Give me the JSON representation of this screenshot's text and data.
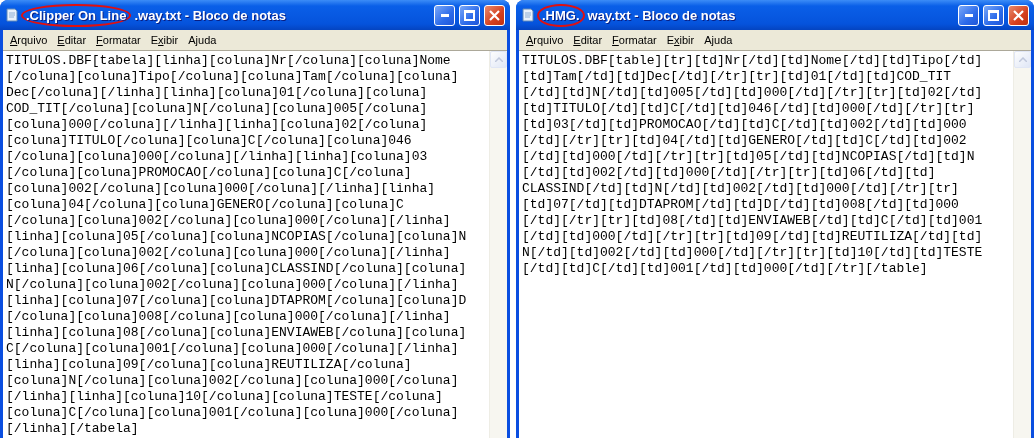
{
  "windows": [
    {
      "title_parts": [
        {
          "text": ".Clipper On Line",
          "circled": true
        },
        {
          "text": ".way.txt - Bloco de notas",
          "circled": false
        }
      ],
      "menu": [
        {
          "key": "A",
          "after": "rquivo"
        },
        {
          "key": "E",
          "after": "ditar"
        },
        {
          "key": "F",
          "after": "ormatar"
        },
        {
          "before": "E",
          "key": "x",
          "after": "ibir"
        },
        {
          "before": "A",
          "key": "j",
          "after": "uda"
        }
      ],
      "lines": [
        "TITULOS.DBF[tabela][linha][coluna]Nr[/coluna][coluna]Nome",
        "[/coluna][coluna]Tipo[/coluna][coluna]Tam[/coluna][coluna]",
        "Dec[/coluna][/linha][linha][coluna]01[/coluna][coluna]",
        "COD_TIT[/coluna][coluna]N[/coluna][coluna]005[/coluna]",
        "[coluna]000[/coluna][/linha][linha][coluna]02[/coluna]",
        "[coluna]TITULO[/coluna][coluna]C[/coluna][coluna]046",
        "[/coluna][coluna]000[/coluna][/linha][linha][coluna]03",
        "[/coluna][coluna]PROMOCAO[/coluna][coluna]C[/coluna]",
        "[coluna]002[/coluna][coluna]000[/coluna][/linha][linha]",
        "[coluna]04[/coluna][coluna]GENERO[/coluna][coluna]C",
        "[/coluna][coluna]002[/coluna][coluna]000[/coluna][/linha]",
        "[linha][coluna]05[/coluna][coluna]NCOPIAS[/coluna][coluna]N",
        "[/coluna][coluna]002[/coluna][coluna]000[/coluna][/linha]",
        "[linha][coluna]06[/coluna][coluna]CLASSIND[/coluna][coluna]",
        "N[/coluna][coluna]002[/coluna][coluna]000[/coluna][/linha]",
        "[linha][coluna]07[/coluna][coluna]DTAPROM[/coluna][coluna]D",
        "[/coluna][coluna]008[/coluna][coluna]000[/coluna][/linha]",
        "[linha][coluna]08[/coluna][coluna]ENVIAWEB[/coluna][coluna]",
        "C[/coluna][coluna]001[/coluna][coluna]000[/coluna][/linha]",
        "[linha][coluna]09[/coluna][coluna]REUTILIZA[/coluna]",
        "[coluna]N[/coluna][coluna]002[/coluna][coluna]000[/coluna]",
        "[/linha][linha][coluna]10[/coluna][coluna]TESTE[/coluna]",
        "[coluna]C[/coluna][coluna]001[/coluna][coluna]000[/coluna]",
        "[/linha][/tabela]"
      ]
    },
    {
      "title_parts": [
        {
          "text": ".HMG.",
          "circled": true
        },
        {
          "text": "way.txt - Bloco de notas",
          "circled": false
        }
      ],
      "menu": [
        {
          "key": "A",
          "after": "rquivo"
        },
        {
          "key": "E",
          "after": "ditar"
        },
        {
          "key": "F",
          "after": "ormatar"
        },
        {
          "before": "E",
          "key": "x",
          "after": "ibir"
        },
        {
          "before": "A",
          "key": "j",
          "after": "uda"
        }
      ],
      "lines": [
        "TITULOS.DBF[table][tr][td]Nr[/td][td]Nome[/td][td]Tipo[/td]",
        "[td]Tam[/td][td]Dec[/td][/tr][tr][td]01[/td][td]COD_TIT",
        "[/td][td]N[/td][td]005[/td][td]000[/td][/tr][tr][td]02[/td]",
        "[td]TITULO[/td][td]C[/td][td]046[/td][td]000[/td][/tr][tr]",
        "[td]03[/td][td]PROMOCAO[/td][td]C[/td][td]002[/td][td]000",
        "[/td][/tr][tr][td]04[/td][td]GENERO[/td][td]C[/td][td]002",
        "[/td][td]000[/td][/tr][tr][td]05[/td][td]NCOPIAS[/td][td]N",
        "[/td][td]002[/td][td]000[/td][/tr][tr][td]06[/td][td]",
        "CLASSIND[/td][td]N[/td][td]002[/td][td]000[/td][/tr][tr]",
        "[td]07[/td][td]DTAPROM[/td][td]D[/td][td]008[/td][td]000",
        "[/td][/tr][tr][td]08[/td][td]ENVIAWEB[/td][td]C[/td][td]001",
        "[/td][td]000[/td][/tr][tr][td]09[/td][td]REUTILIZA[/td][td]",
        "N[/td][td]002[/td][td]000[/td][/tr][tr][td]10[/td][td]TESTE",
        "[/td][td]C[/td][td]001[/td][td]000[/td][/tr][/table]"
      ]
    }
  ]
}
